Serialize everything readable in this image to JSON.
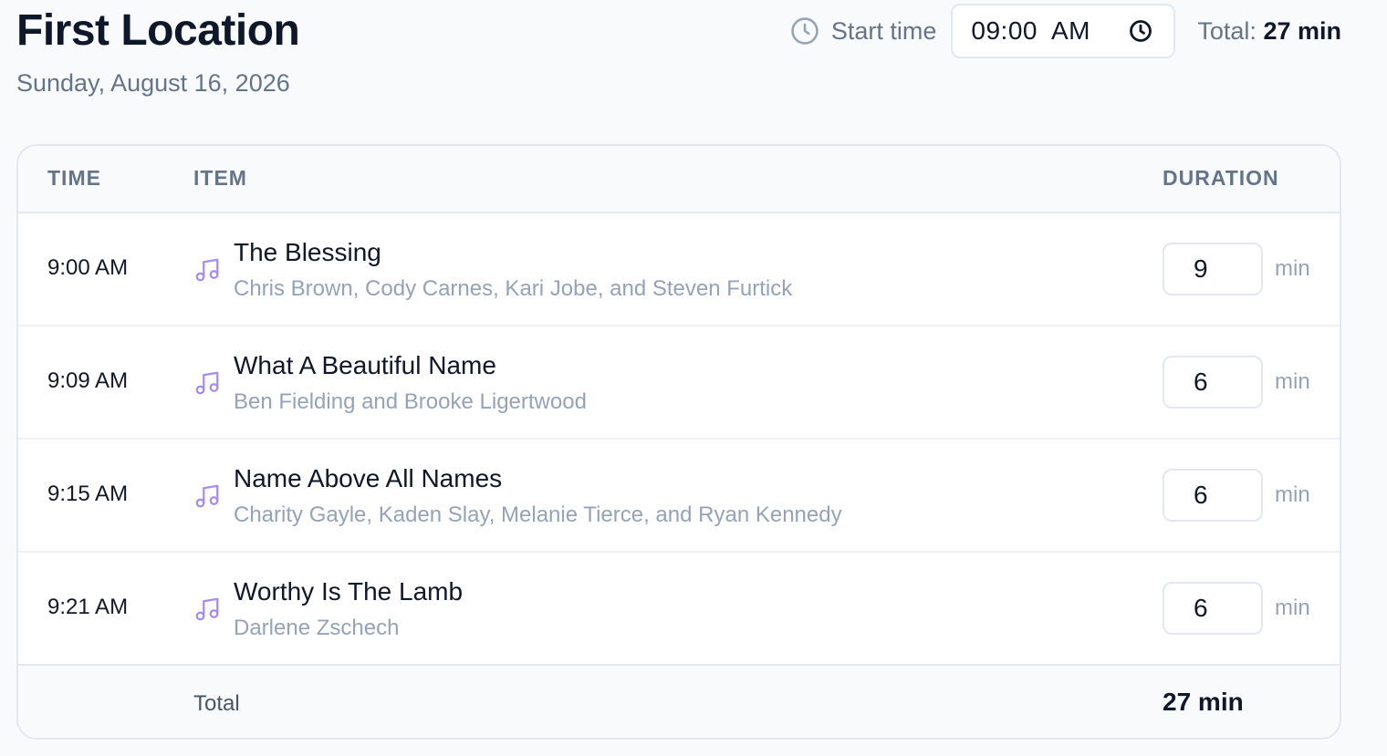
{
  "header": {
    "title": "First Location",
    "date": "Sunday, August 16, 2026",
    "start_time_label": "Start time",
    "start_time_value": "09:00  AM",
    "total_label": "Total:",
    "total_value": "27 min"
  },
  "table": {
    "columns": {
      "time": "TIME",
      "item": "ITEM",
      "duration": "DURATION"
    },
    "rows": [
      {
        "time": "9:00 AM",
        "title": "The Blessing",
        "artist": "Chris Brown, Cody Carnes, Kari Jobe, and Steven Furtick",
        "duration": "9",
        "unit": "min"
      },
      {
        "time": "9:09 AM",
        "title": "What A Beautiful Name",
        "artist": "Ben Fielding and Brooke Ligertwood",
        "duration": "6",
        "unit": "min"
      },
      {
        "time": "9:15 AM",
        "title": "Name Above All Names",
        "artist": "Charity Gayle, Kaden Slay, Melanie Tierce, and Ryan Kennedy",
        "duration": "6",
        "unit": "min"
      },
      {
        "time": "9:21 AM",
        "title": "Worthy Is The Lamb",
        "artist": "Darlene Zschech",
        "duration": "6",
        "unit": "min"
      }
    ],
    "footer": {
      "label": "Total",
      "value": "27 min"
    }
  },
  "icons": {
    "clock": "clock-icon",
    "time_picker": "clock-icon",
    "item": "music-note-icon"
  },
  "colors": {
    "accent": "#a78bfa",
    "muted": "#64748b",
    "text": "#0f172a",
    "border": "#e2e8f0"
  }
}
